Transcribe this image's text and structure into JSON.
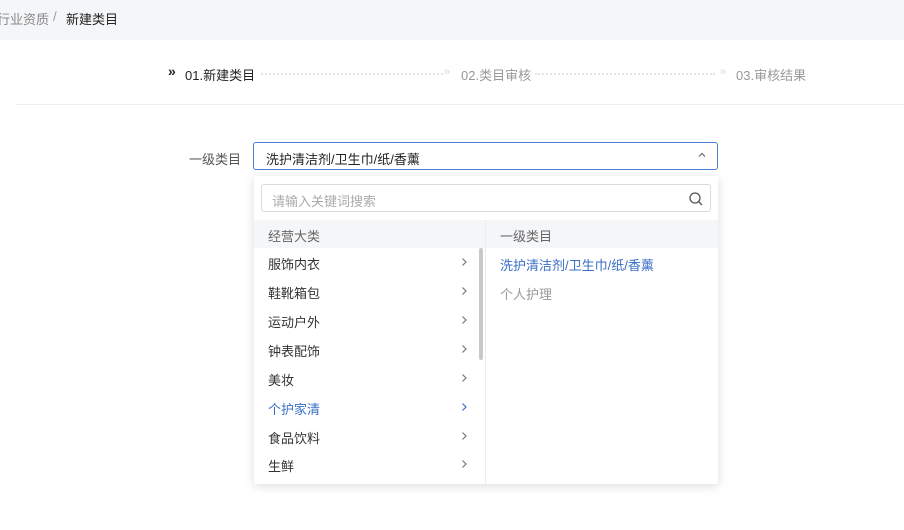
{
  "breadcrumb": {
    "previous": "行业资质",
    "separator": "/",
    "current": "新建类目"
  },
  "steps": [
    {
      "label": "01.新建类目",
      "state": "active"
    },
    {
      "label": "02.类目审核",
      "state": "pending"
    },
    {
      "label": "03.审核结果",
      "state": "pending"
    }
  ],
  "form": {
    "label": "一级类目",
    "selected_value": "洗护清洁剂/卫生巾/纸/香薰"
  },
  "dropdown": {
    "search_placeholder": "请输入关键词搜索",
    "left_header": "经营大类",
    "right_header": "一级类目",
    "categories": [
      {
        "label": "服饰内衣",
        "active": false
      },
      {
        "label": "鞋靴箱包",
        "active": false
      },
      {
        "label": "运动户外",
        "active": false
      },
      {
        "label": "钟表配饰",
        "active": false
      },
      {
        "label": "美妆",
        "active": false
      },
      {
        "label": "个护家清",
        "active": true
      },
      {
        "label": "食品饮料",
        "active": false
      },
      {
        "label": "生鲜",
        "active": false
      }
    ],
    "subcategories": [
      {
        "label": "洗护清洁剂/卫生巾/纸/香薰",
        "state": "selected"
      },
      {
        "label": "个人护理",
        "state": "disabled"
      }
    ]
  },
  "colors": {
    "accent": "#3a6fc5",
    "border_focus": "#4a7fd4",
    "muted_text": "#999999"
  }
}
